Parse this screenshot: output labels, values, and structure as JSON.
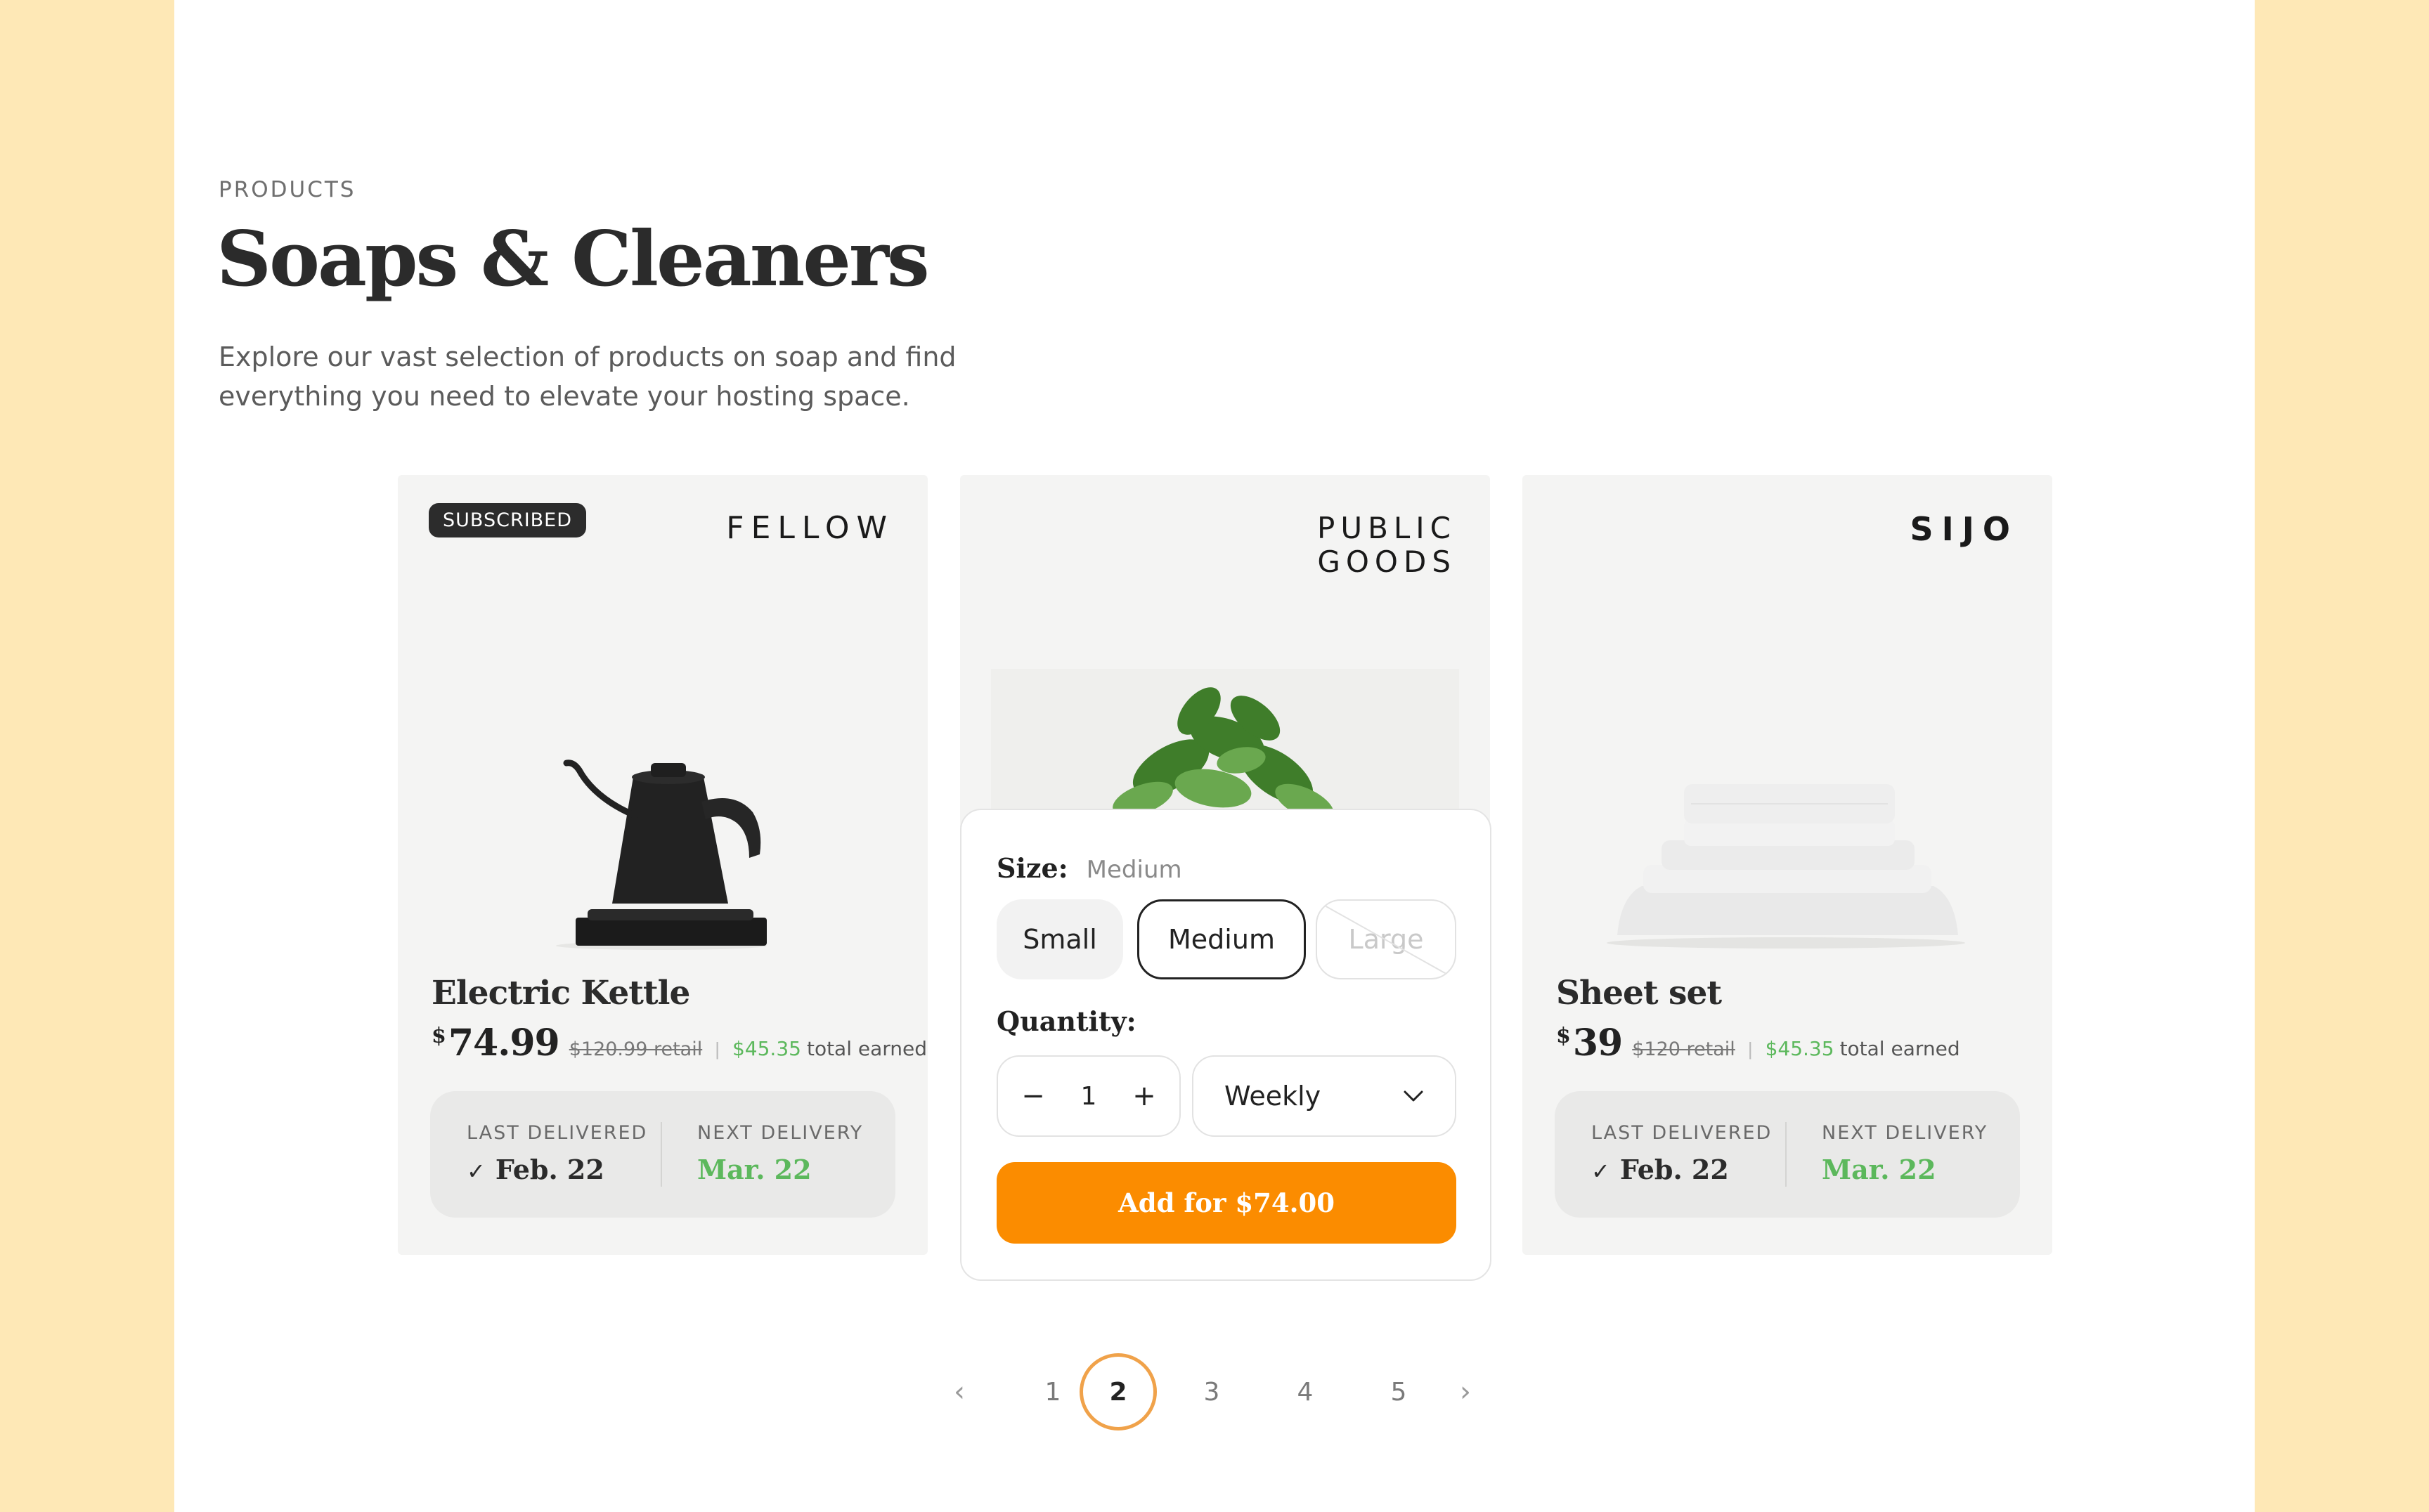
{
  "section": {
    "eyebrow": "PRODUCTS",
    "title": "Soaps & Cleaners",
    "intro_line1": "Explore our vast selection of products on soap and find",
    "intro_line2": "everything you need to elevate your hosting space."
  },
  "products": [
    {
      "badge": "SUBSCRIBED",
      "brand": "FELLOW",
      "name": "Electric Kettle",
      "price_symbol": "$",
      "price": "74.99",
      "retail": "$120.99 retail",
      "earned_amount": "$45.35",
      "earned_label": "total earned",
      "last_delivered_label": "LAST DELIVERED",
      "last_delivered": "Feb. 22",
      "next_delivery_label": "NEXT DELIVERY",
      "next_delivery": "Mar. 22",
      "image_icon": "kettle-image"
    },
    {
      "brand_line1": "PUBLIC",
      "brand_line2": "GOODS",
      "image_icon": "plant-image"
    },
    {
      "brand": "SIJO",
      "name": "Sheet set",
      "price_symbol": "$",
      "price": "39",
      "retail": "$120 retail",
      "earned_amount": "$45.35",
      "earned_label": "total earned",
      "last_delivered_label": "LAST DELIVERED",
      "last_delivered": "Feb. 22",
      "next_delivery_label": "NEXT DELIVERY",
      "next_delivery": "Mar. 22",
      "image_icon": "sheets-image"
    }
  ],
  "popover": {
    "size_label": "Size:",
    "size_value": "Medium",
    "sizes": [
      "Small",
      "Medium",
      "Large"
    ],
    "selected_size": "Medium",
    "unavailable_size": "Large",
    "quantity_label": "Quantity:",
    "quantity": "1",
    "decrement": "−",
    "increment": "+",
    "frequency": "Weekly",
    "add_button": "Add for $74.00"
  },
  "pagination": {
    "prev": "‹",
    "pages": [
      "1",
      "2",
      "3",
      "4",
      "5"
    ],
    "current": "2",
    "next": "›"
  },
  "colors": {
    "background": "#FEE8B6",
    "accent_orange": "#FB8C00",
    "earned_green": "#5CB85C",
    "pager_ring": "#F0A24A"
  }
}
